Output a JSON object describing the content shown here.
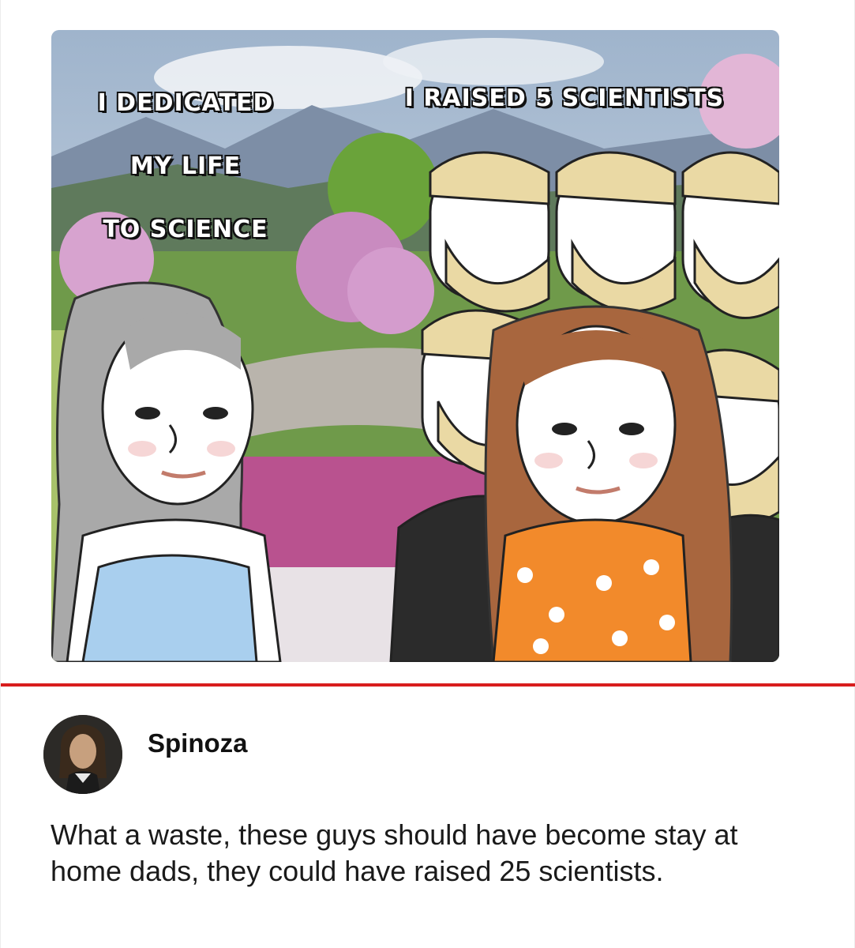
{
  "meme": {
    "left_caption_lines": [
      "I DEDICATED",
      "MY LIFE",
      "TO SCIENCE"
    ],
    "right_caption": "I RAISED 5 SCIENTISTS"
  },
  "post": {
    "author": "Spinoza",
    "comment": "What a waste, these guys should have become stay at home dads, they could have raised 25 scientists."
  },
  "colors": {
    "divider": "#d81d1d",
    "left_dress": "#a9cfee",
    "right_dress": "#f28a2b",
    "hair_blond": "#ead9a4"
  },
  "icons": [
    "profile-avatar"
  ]
}
